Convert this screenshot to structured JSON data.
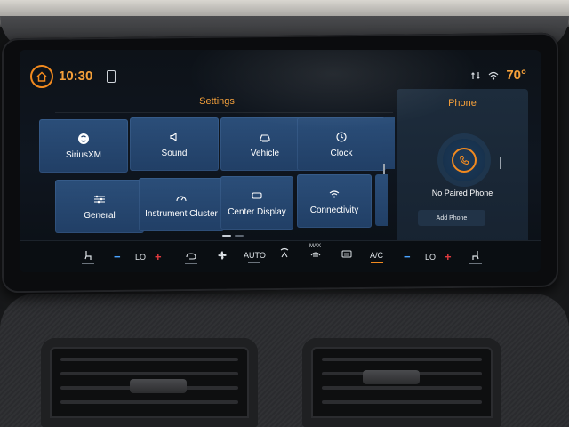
{
  "status_bar": {
    "time": "10:30",
    "temperature": "70°"
  },
  "settings": {
    "title": "Settings",
    "tiles": [
      {
        "label": "SiriusXM",
        "icon": "siriusxm-icon"
      },
      {
        "label": "Sound",
        "icon": "speaker-icon"
      },
      {
        "label": "Vehicle",
        "icon": "vehicle-icon"
      },
      {
        "label": "Clock",
        "icon": "clock-icon"
      },
      {
        "label": "General",
        "icon": "sliders-icon"
      },
      {
        "label": "Instrument Cluster",
        "icon": "gauge-icon"
      },
      {
        "label": "Center Display",
        "icon": "display-icon"
      },
      {
        "label": "Connectivity",
        "icon": "wifi-icon"
      }
    ]
  },
  "phone_panel": {
    "title": "Phone",
    "status": "No Paired Phone",
    "add_button": "Add Phone"
  },
  "climate": {
    "driver_temp": "LO",
    "fan_mode": "AUTO",
    "max_label": "MAX",
    "ac_label": "A/C",
    "passenger_temp": "LO",
    "minus": "−",
    "plus": "+"
  },
  "colors": {
    "accent": "#f28a1f",
    "tile_blue": "#2b4e79",
    "minus_blue": "#4aa3ff",
    "plus_red": "#e0393e"
  }
}
